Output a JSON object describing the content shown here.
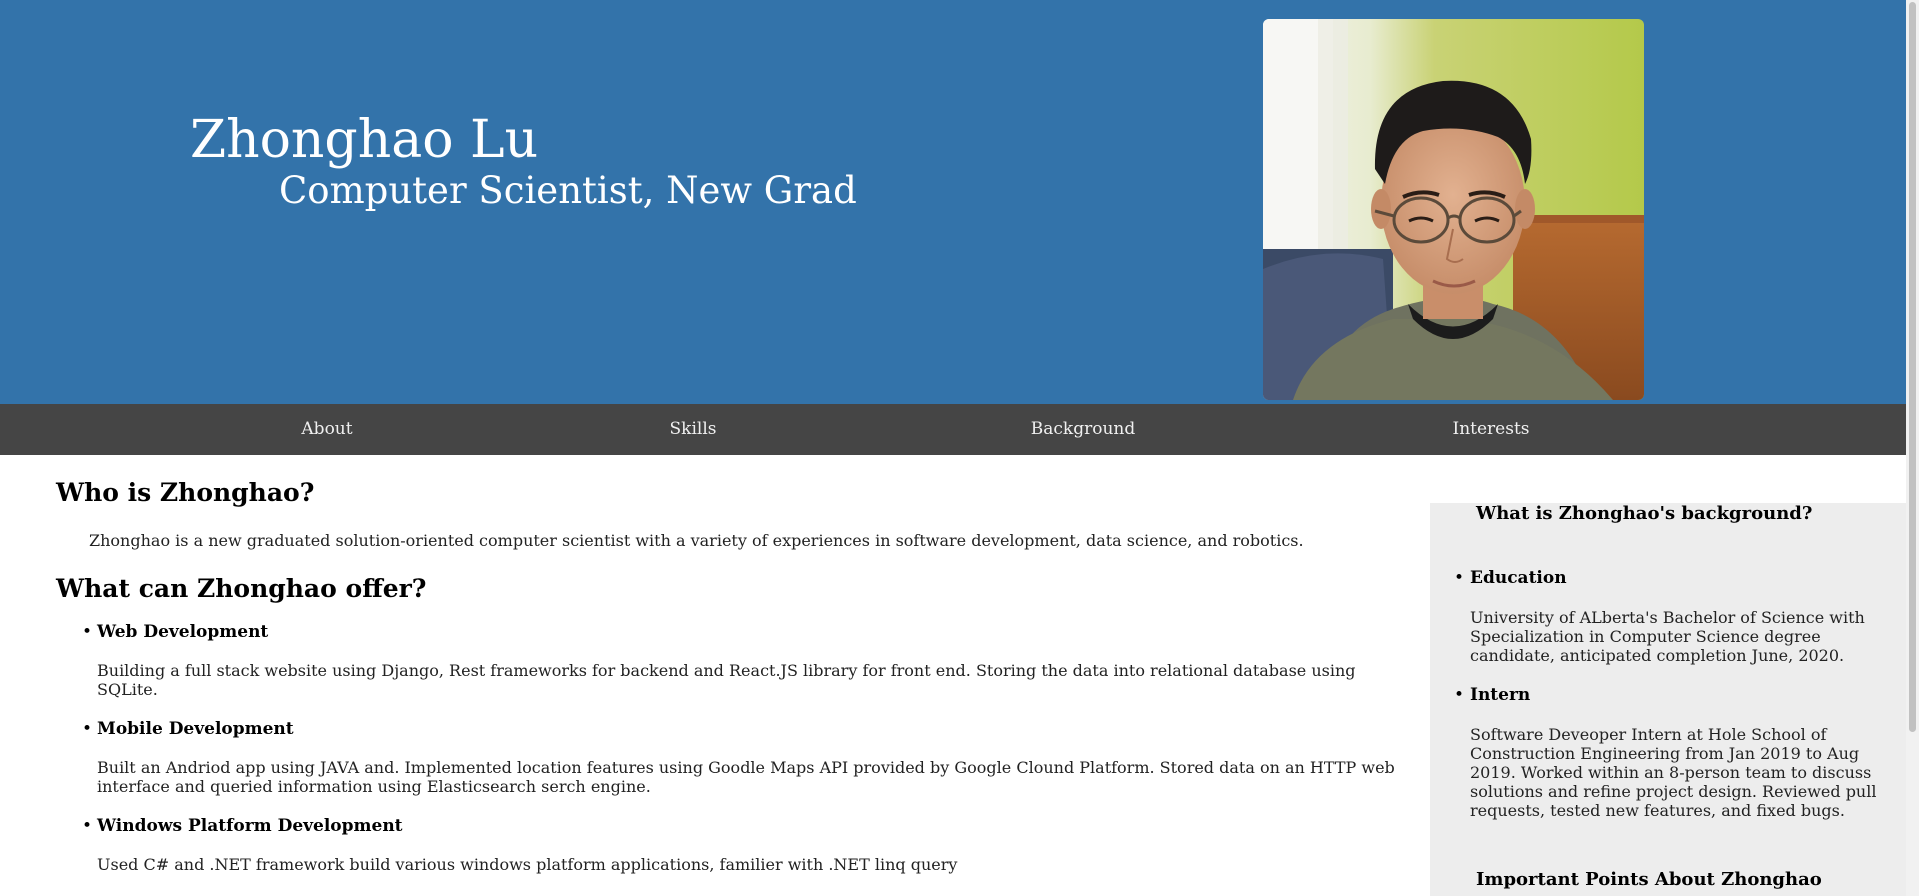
{
  "header": {
    "name": "Zhonghao Lu",
    "tagline": "Computer Scientist, New Grad",
    "header_color": "#3373aa"
  },
  "nav": {
    "items": [
      {
        "label": "About"
      },
      {
        "label": "Skills"
      },
      {
        "label": "Background"
      },
      {
        "label": "Interests"
      }
    ],
    "bar_color": "#454545"
  },
  "main": {
    "about_heading": "Who is Zhonghao?",
    "about_text": "Zhonghao is a new graduated solution-oriented computer scientist with a variety of experiences in software development, data science, and robotics.",
    "offer_heading": "What can Zhonghao offer?",
    "offers": [
      {
        "title": "Web Development",
        "desc": "Building a full stack website using Django, Rest frameworks for backend and React.JS library for front end. Storing the data into relational database using SQLite."
      },
      {
        "title": "Mobile Development",
        "desc": "Built an Andriod app using JAVA and. Implemented location features using Goodle Maps API provided by Google Clound Platform. Stored data on an HTTP web interface and queried information using Elasticsearch serch engine."
      },
      {
        "title": "Windows Platform Development",
        "desc": "Used C# and .NET framework build various windows platform applications, familier with .NET linq query"
      }
    ]
  },
  "sidebar": {
    "background_heading": "What is Zhonghao's background?",
    "items": [
      {
        "title": "Education",
        "desc": "University of ALberta's Bachelor of Science with Specialization in Computer Science degree candidate, anticipated completion June, 2020."
      },
      {
        "title": "Intern",
        "desc": "Software Deveoper Intern at Hole School of Construction Engineering from Jan 2019 to Aug 2019. Worked within an 8-person team to discuss solutions and refine project design. Reviewed pull requests, tested new features, and fixed bugs."
      }
    ],
    "points_heading": "Important Points About Zhonghao",
    "sidebar_color": "#ededed"
  }
}
